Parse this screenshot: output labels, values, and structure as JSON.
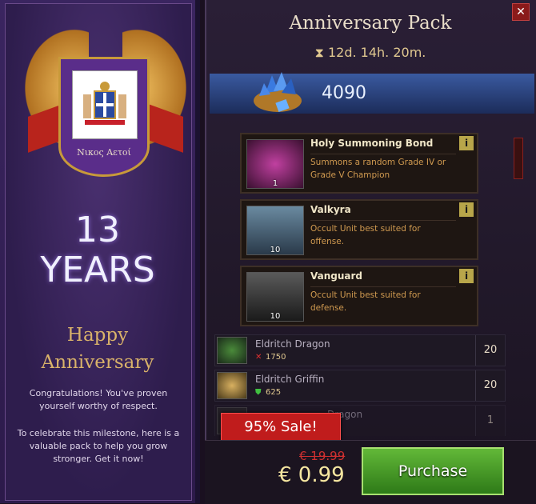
{
  "banner": {
    "guild_name": "Νικος Αετοί",
    "years_number": "13",
    "years_label": "YEARS",
    "happy_line1": "Happy",
    "happy_line2": "Anniversary",
    "congrats": "Congratulations! You've proven yourself worthy of respect.",
    "celebrate": "To celebrate this milestone, here is a valuable pack to help you grow stronger. Get it now!"
  },
  "pack": {
    "close": "✕",
    "title": "Anniversary Pack",
    "timer": "12d. 14h. 20m.",
    "gems": "4090"
  },
  "cards": [
    {
      "name": "Holy Summoning Bond",
      "desc": "Summons a random Grade IV or Grade V Champion",
      "qty": "1",
      "info": "i",
      "color": "#7a2a6a"
    },
    {
      "name": "Valkyra",
      "desc": "Occult Unit best suited for offense.",
      "qty": "10",
      "info": "i",
      "color": "#4a5a6a"
    },
    {
      "name": "Vanguard",
      "desc": "Occult Unit best suited for defense.",
      "qty": "10",
      "info": "i",
      "color": "#3a3a3a"
    }
  ],
  "rows": [
    {
      "name": "Eldritch Dragon",
      "power": "1750",
      "power_icon": "sword-icon",
      "count": "20",
      "color": "#2a4a2a"
    },
    {
      "name": "Eldritch Griffin",
      "power": "625",
      "power_icon": "shield-icon",
      "count": "20",
      "color": "#6a5a2a"
    },
    {
      "name": "Dragon",
      "power": "",
      "count": "1",
      "color": "#2a2a2a"
    }
  ],
  "sale": "95% Sale!",
  "price": {
    "old": "€ 19.99",
    "new": "€ 0.99",
    "buy": "Purchase"
  }
}
